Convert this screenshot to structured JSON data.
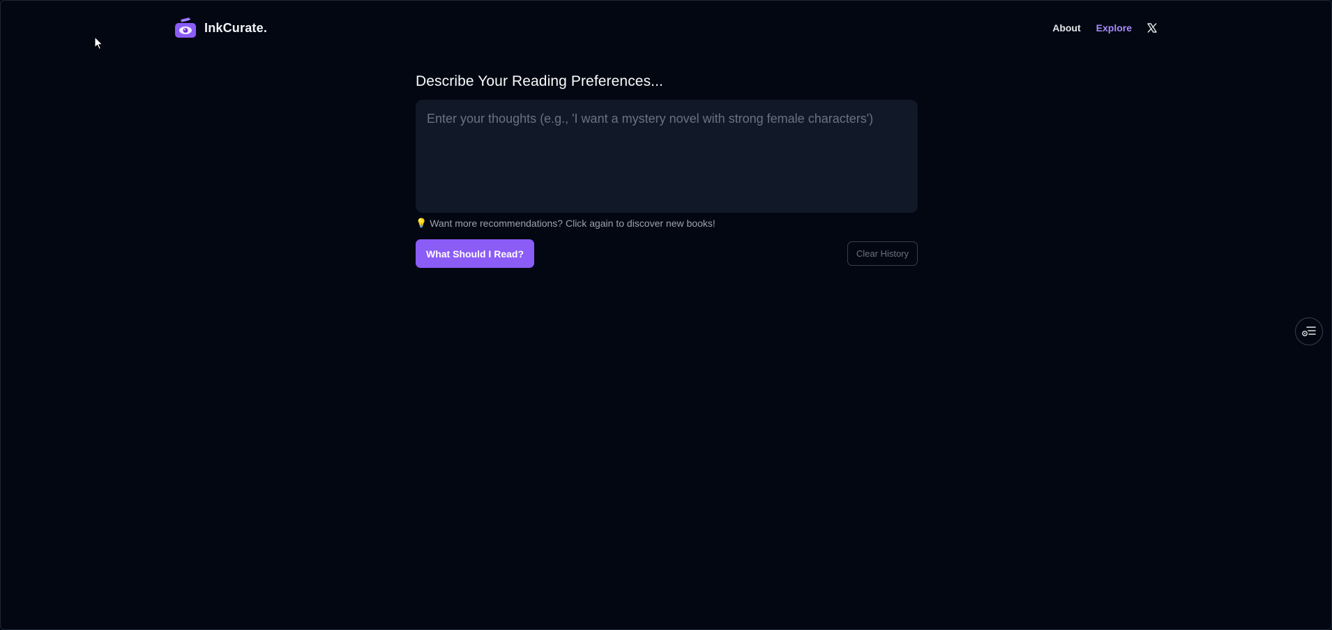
{
  "header": {
    "brand_name": "InkCurate.",
    "nav": {
      "about": "About",
      "explore": "Explore"
    }
  },
  "main": {
    "heading": "Describe Your Reading Preferences...",
    "textarea": {
      "value": "",
      "placeholder": "Enter your thoughts (e.g., 'I want a mystery novel with strong female characters')"
    },
    "hint": "Want more recommendations? Click again to discover new books!",
    "primary_button": "What Should I Read?",
    "secondary_button": "Clear History"
  },
  "colors": {
    "background": "#030712",
    "accent": "#8b5cf6",
    "accent_text": "#a78bfa",
    "input_bg": "#111827"
  },
  "icons": {
    "brand": "book-eye-logo-icon",
    "social": "x-icon",
    "hint": "lightbulb-icon",
    "floating": "list-settings-icon"
  }
}
